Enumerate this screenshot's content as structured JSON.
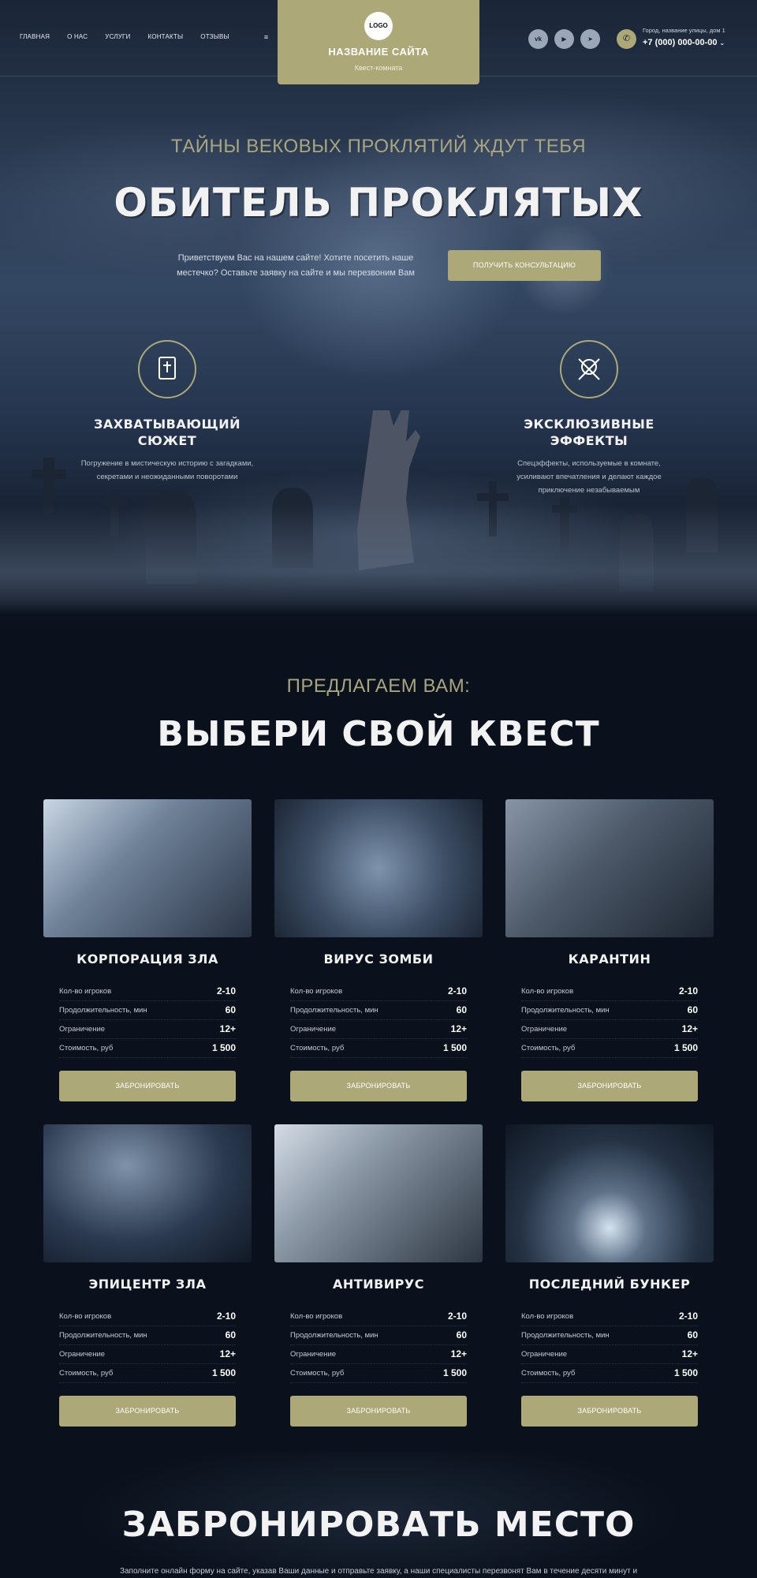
{
  "header": {
    "nav": [
      "ГЛАВНАЯ",
      "О НАС",
      "УСЛУГИ",
      "КОНТАКТЫ",
      "ОТЗЫВЫ"
    ],
    "menu_icon": "≡",
    "logo": "LOGO",
    "site_name": "НАЗВАНИЕ САЙТА",
    "site_sub": "Квест-комната",
    "socials": [
      {
        "icon": "vk-icon",
        "glyph": "vk"
      },
      {
        "icon": "youtube-icon",
        "glyph": "▶"
      },
      {
        "icon": "telegram-icon",
        "glyph": "➤"
      }
    ],
    "address": "Город, название улицы, дом 1",
    "phone": "+7 (000) 000-00-00"
  },
  "hero": {
    "subtitle": "ТАЙНЫ ВЕКОВЫХ ПРОКЛЯТИЙ ЖДУТ ТЕБЯ",
    "title": "ОБИТЕЛЬ ПРОКЛЯТЫХ",
    "description": "Приветствуем Вас на нашем сайте! Хотите посетить наше местечко? Оставьте заявку на сайте и мы перезвоним Вам",
    "cta": "ПОЛУЧИТЬ КОНСУЛЬТАЦИЮ",
    "features": [
      {
        "icon": "bible-icon",
        "title": "ЗАХВАТЫВАЮЩИЙ СЮЖЕТ",
        "text": "Погружение в мистическую историю с загадками, секретами и неожиданными поворотами"
      },
      {
        "icon": "skull-crossbones-icon",
        "title": "ЭКСКЛЮЗИВНЫЕ ЭФФЕКТЫ",
        "text": "Спецэффекты, используемые в комнате, усиливают впечатления и делают каждое приключение незабываемым"
      }
    ]
  },
  "quests": {
    "subtitle": "ПРЕДЛАГАЕМ ВАМ:",
    "title": "ВЫБЕРИ СВОЙ КВЕСТ",
    "labels": {
      "players": "Кол-во игроков",
      "duration": "Продолжительность, мин",
      "limit": "Ограничение",
      "price": "Стоимость, руб"
    },
    "book_label": "ЗАБРОНИРОВАТЬ",
    "items": [
      {
        "title": "КОРПОРАЦИЯ ЗЛА",
        "players": "2-10",
        "duration": "60",
        "limit": "12+",
        "price": "1 500"
      },
      {
        "title": "ВИРУС ЗОМБИ",
        "players": "2-10",
        "duration": "60",
        "limit": "12+",
        "price": "1 500"
      },
      {
        "title": "КАРАНТИН",
        "players": "2-10",
        "duration": "60",
        "limit": "12+",
        "price": "1 500"
      },
      {
        "title": "ЭПИЦЕНТР ЗЛА",
        "players": "2-10",
        "duration": "60",
        "limit": "12+",
        "price": "1 500"
      },
      {
        "title": "АНТИВИРУС",
        "players": "2-10",
        "duration": "60",
        "limit": "12+",
        "price": "1 500"
      },
      {
        "title": "ПОСЛЕДНИЙ БУНКЕР",
        "players": "2-10",
        "duration": "60",
        "limit": "12+",
        "price": "1 500"
      }
    ]
  },
  "booking": {
    "title": "ЗАБРОНИРОВАТЬ МЕСТО",
    "description": "Заполните онлайн форму на сайте, указав Ваши данные и отправьте заявку, а наши специалисты перезвонят Вам в течение десяти минут и"
  },
  "colors": {
    "accent": "#aca877",
    "background": "#0a111c"
  }
}
